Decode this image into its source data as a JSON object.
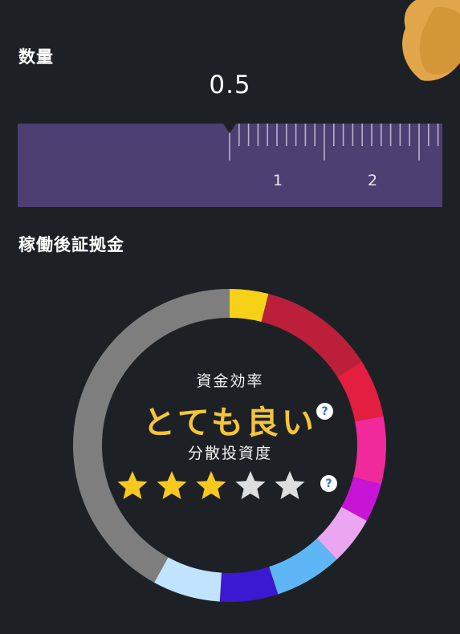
{
  "quantity": {
    "title": "数量",
    "value": "0.5",
    "scale_labels": [
      "1",
      "2"
    ]
  },
  "margin": {
    "title": "稼働後証拠金"
  },
  "gauge": {
    "segments": [
      {
        "color": "#f7d117",
        "value": 4
      },
      {
        "color": "#bb1f3a",
        "value": 12
      },
      {
        "color": "#e31e3e",
        "value": 6
      },
      {
        "color": "#f02a9b",
        "value": 7
      },
      {
        "color": "#c814d6",
        "value": 4
      },
      {
        "color": "#eaa6f1",
        "value": 5
      },
      {
        "color": "#5fb6f4",
        "value": 7
      },
      {
        "color": "#3b18d1",
        "value": 6
      },
      {
        "color": "#c0e3ff",
        "value": 7
      },
      {
        "color": "#7e7e7e",
        "value": 42
      }
    ],
    "efficiency_label": "資金効率",
    "efficiency_rating": "とても良い",
    "diversity_label": "分散投資度",
    "diversity_stars": 3,
    "max_stars": 5,
    "help_glyph": "?"
  },
  "colors": {
    "background": "#1d2125",
    "ruler_bg": "#4e3f72",
    "rating": "#f4c43a",
    "star_filled": "#f7c81e",
    "star_empty": "#dedede"
  }
}
